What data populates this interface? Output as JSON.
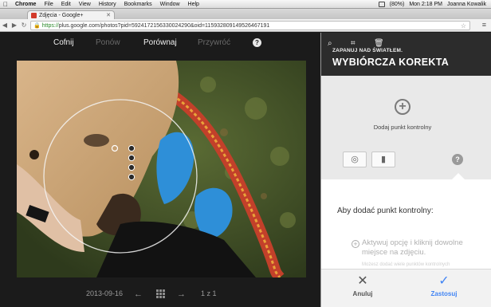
{
  "menubar": {
    "apple": "",
    "items": [
      "Chrome",
      "File",
      "Edit",
      "View",
      "History",
      "Bookmarks",
      "Window",
      "Help"
    ],
    "battery": "(80%)",
    "clock": "Mon 2:18 PM",
    "user": "Joanna Kowalik"
  },
  "browser": {
    "tab_title": "Zdjęcia - Google+",
    "url_scheme": "https://",
    "url_rest": "plus.google.com/photos?pid=5924172156330024290&oid=115932809149526467191"
  },
  "editor": {
    "undo": "Cofnij",
    "redo": "Ponów",
    "compare": "Porównaj",
    "restore": "Przywróć",
    "help": "?",
    "date": "2013-09-16",
    "counter": "1 z 1"
  },
  "panel": {
    "save_label": "ZAPANUJ NAD ŚWIATŁEM.",
    "title": "WYBIÓRCZA KOREKTA",
    "add_point": "Dodaj punkt kontrolny",
    "help": "?",
    "card_title": "Aby dodać punkt kontrolny:",
    "card_text": "Aktywuj opcję i kliknij dowolne miejsce na zdjęciu.",
    "card_fade": "Możesz dodać wiele punktów kontrolnych",
    "cancel": "Anuluj",
    "apply": "Zastosuj"
  },
  "icons": {
    "zoom": "zoom-icon",
    "crop": "crop-icon",
    "trash": "trash-icon",
    "copy": "copy-control-point-icon",
    "delete": "delete-control-point-icon"
  },
  "colors": {
    "accent": "#4285f4",
    "panel_dark": "#2c2c2c",
    "editor_bg": "#1b1b1b"
  }
}
